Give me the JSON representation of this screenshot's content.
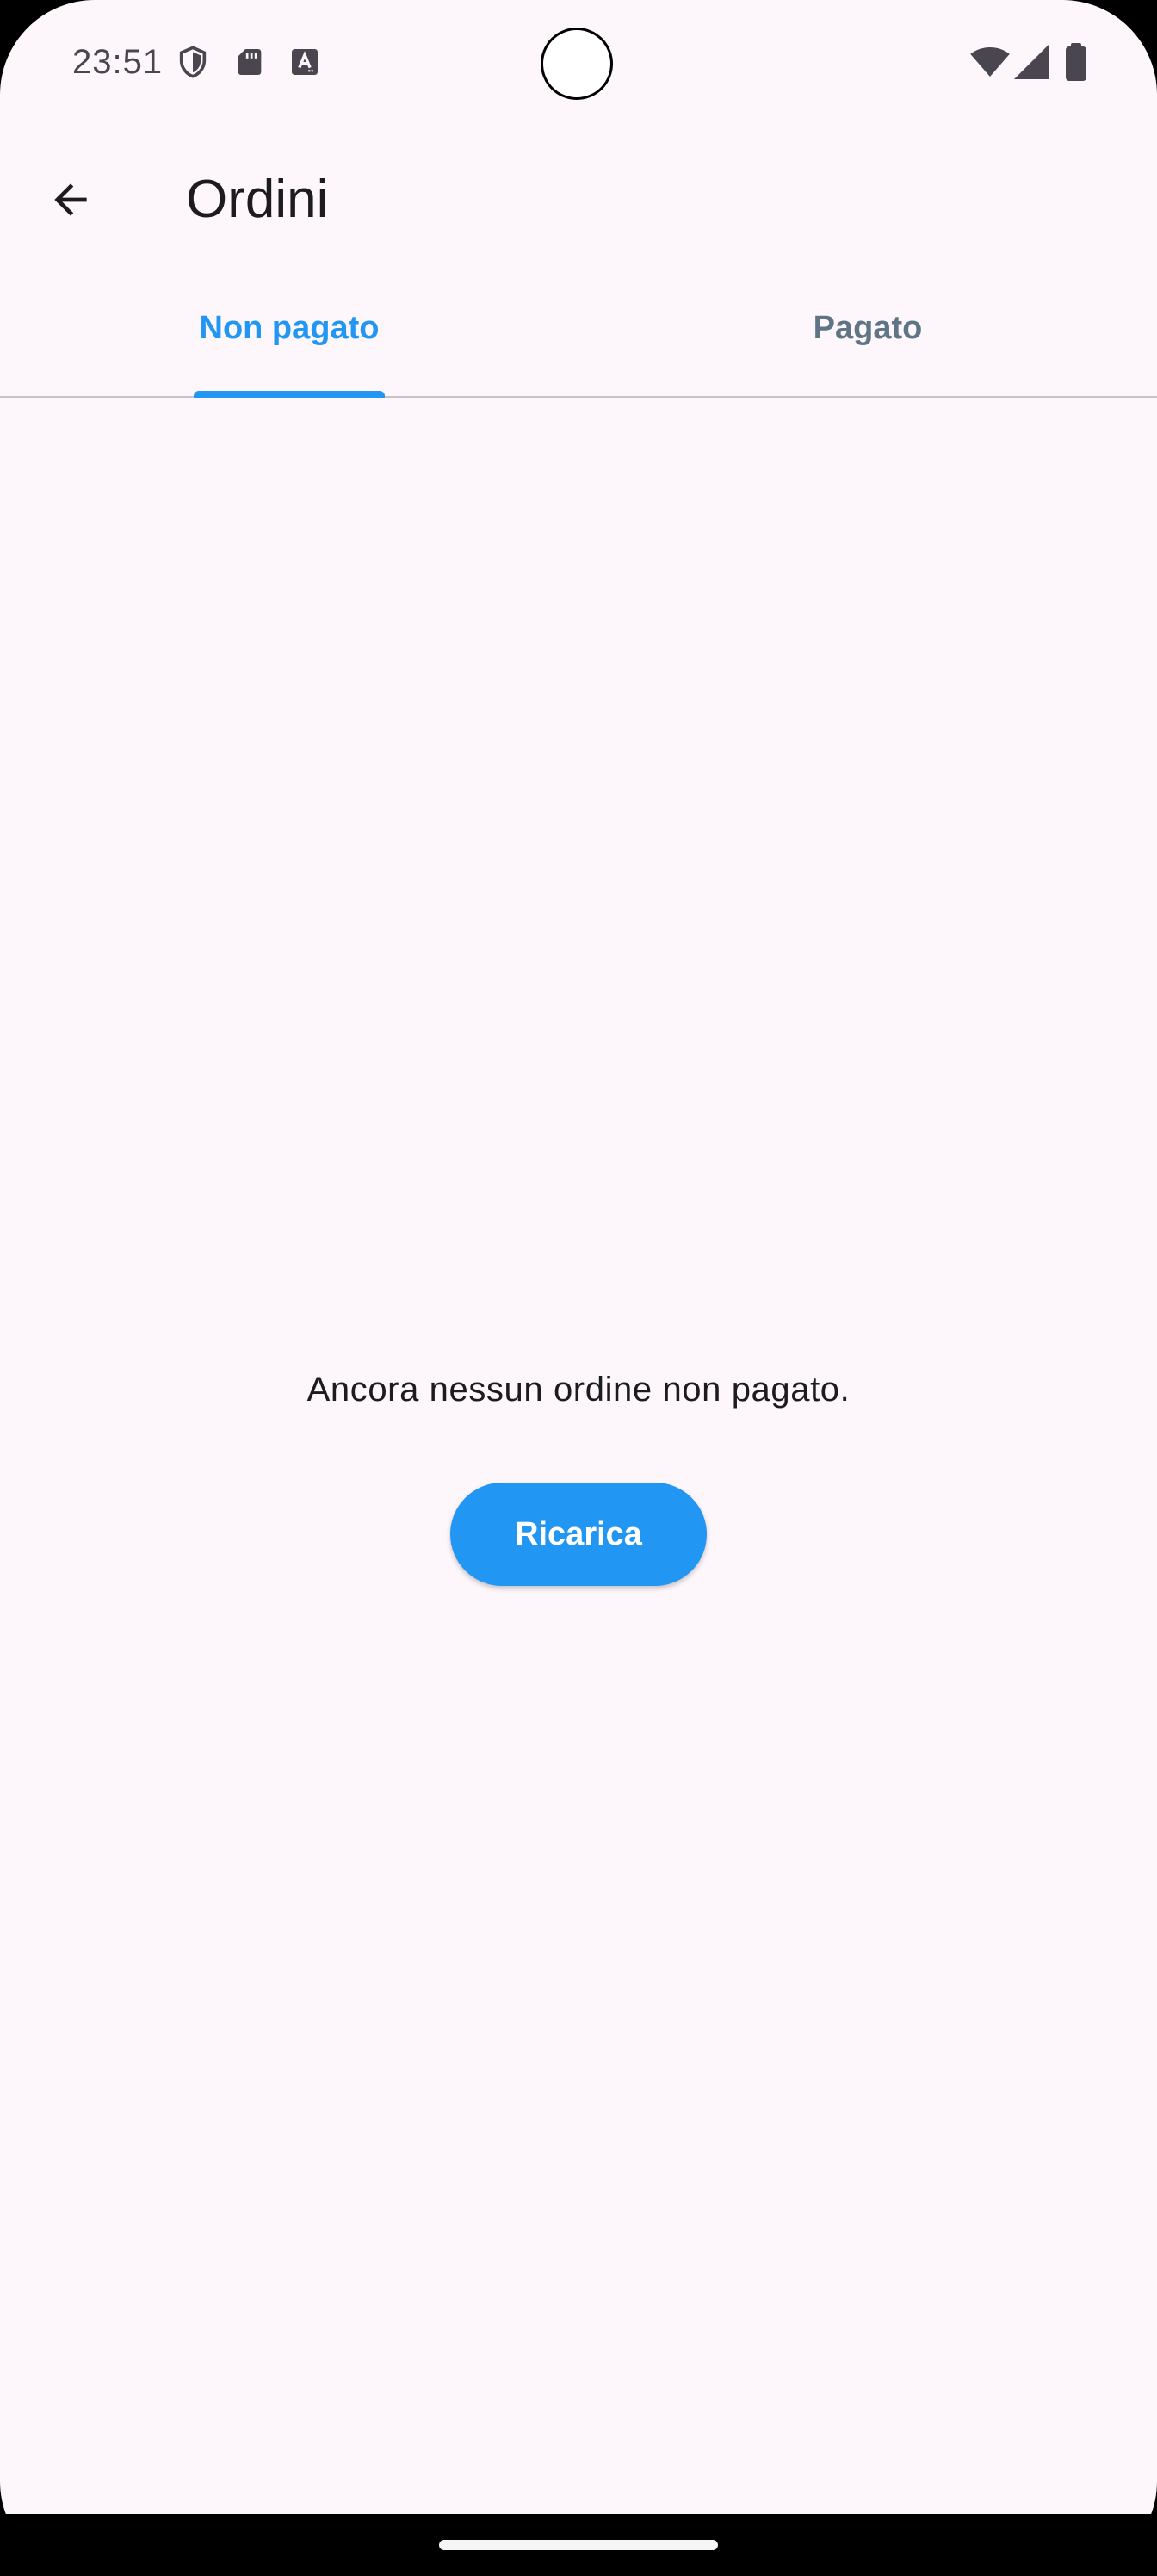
{
  "status_bar": {
    "time": "23:51",
    "icons_left": [
      "shield-icon",
      "sd-card-icon",
      "keyboard-a-icon"
    ],
    "icons_right": [
      "wifi-icon",
      "signal-icon",
      "battery-icon"
    ]
  },
  "app_bar": {
    "back_icon": "arrow-back-icon",
    "title": "Ordini"
  },
  "tabs": [
    {
      "label": "Non pagato",
      "selected": true
    },
    {
      "label": "Pagato",
      "selected": false
    }
  ],
  "main": {
    "empty_message": "Ancora nessun ordine non pagato.",
    "reload_button_label": "Ricarica"
  },
  "colors": {
    "accent": "#2196f3",
    "background": "#fdf7fc",
    "inactive_tab": "#5f7585",
    "text_primary": "#1c1b1f"
  }
}
